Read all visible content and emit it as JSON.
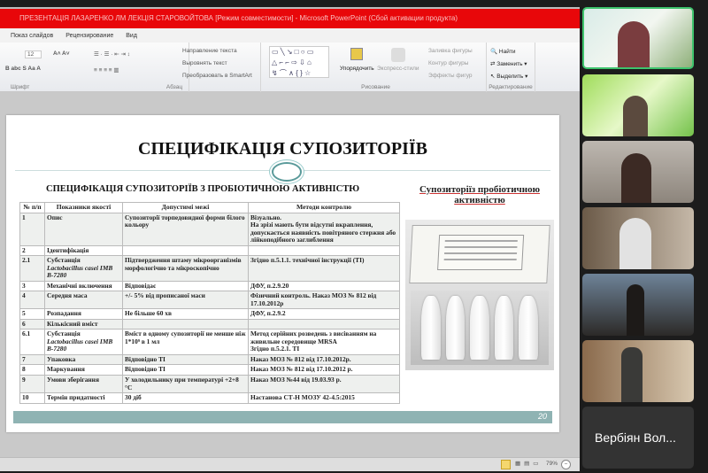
{
  "window": {
    "title": "ПРЕЗЕНТАЦІЯ ЛАЗАРЕНКО ЛМ ЛЕКЦІЯ СТАРОВОЙТОВА [Режим совместимости] - Microsoft PowerPoint (Сбой активации продукта)"
  },
  "menu": [
    "Показ слайдов",
    "Рецензирование",
    "Вид"
  ],
  "ribbon": {
    "font_size": "12",
    "text_direction": "Направление текста",
    "align_text": "Выровнять текст",
    "smartart": "Преобразовать в SmartArt",
    "arrange": "Упорядочить",
    "quick_styles": "Экспресс-стили",
    "fill": "Заливка фигуры",
    "outline": "Контур фигуры",
    "effects": "Эффекты фигур",
    "find": "Найти",
    "replace": "Заменить",
    "select": "Выделить",
    "groups": {
      "font": "Шрифт",
      "paragraph": "Абзац",
      "drawing": "Рисование",
      "editing": "Редактирование"
    }
  },
  "slide": {
    "title": "СПЕЦИФІКАЦІЯ СУПОЗИТОРІЇВ",
    "subtitle": "СПЕЦИФІКАЦІЯ  СУПОЗИТОРІЇВ З ПРОБІОТИЧНОЮ  АКТИВНІСТЮ",
    "right_title": "Супозиторіїз пробіотичною активністю",
    "page": "20",
    "headers": [
      "№ п/п",
      "Показники якості",
      "Допустимі межі",
      "Методи контролю"
    ],
    "rows": [
      [
        "1",
        "Опис",
        "",
        "Супозиторії торпедовидної форми білого кольору",
        "Візуально.\nНа зрізі мають бути відсутні вкраплення, допускається наявність повітряного стержня або\nлійкоподібного заглиблення"
      ],
      [
        "2",
        "Ідентифікація",
        "",
        "",
        ""
      ],
      [
        "2.1",
        "Субстанція",
        "Lactobacillus casei IMB B-7280",
        "Підтвердження штаму мікроорганізмів морфологічно та мікроскопічно",
        "Згідно п.5.1.1. технічної інструкції (ТІ)"
      ],
      [
        "3",
        "Механічні включення",
        "",
        "Відповідає",
        "ДФУ, п.2.9.20"
      ],
      [
        "4",
        "Середня маса",
        "",
        "+/- 5% від прописаної маси",
        "Фізичний контроль. Наказ МОЗ № 812 від 17.10.2012р"
      ],
      [
        "5",
        "Розпадання",
        "",
        "Не більше 60 хв",
        "ДФУ, п.2.9.2"
      ],
      [
        "6",
        "Кількісний вміст",
        "",
        "",
        ""
      ],
      [
        "6.1",
        "Субстанція",
        "Lactobacillus casei IMB B-7280",
        "Вміст в одному супозиторії не менше ніж 1*10⁹ в 1 мл",
        "Метод серійних розведень з висіванням на живильне середовище MRSA\nЗгідно п.5.2.1. ТІ"
      ],
      [
        "7",
        "Упаковка",
        "",
        "Відповідно ТІ",
        "Наказ МОЗ № 812 від 17.10.2012р."
      ],
      [
        "8",
        "Маркування",
        "",
        "Відповідно ТІ",
        "Наказ МОЗ № 812 від 17.10.2012 р."
      ],
      [
        "9",
        "Умови зберігання",
        "",
        "У холодильнику при температурі +2+8 °С",
        "Наказ МОЗ №44 від 19.03.93 р."
      ],
      [
        "10",
        "Термін придатності",
        "",
        "30 діб",
        "Настанова СТ-Н МОЗУ 42-4.5:2015"
      ]
    ]
  },
  "status": {
    "zoom": "79%"
  },
  "participants": [
    {
      "name": "Вербіян Вол..."
    }
  ]
}
